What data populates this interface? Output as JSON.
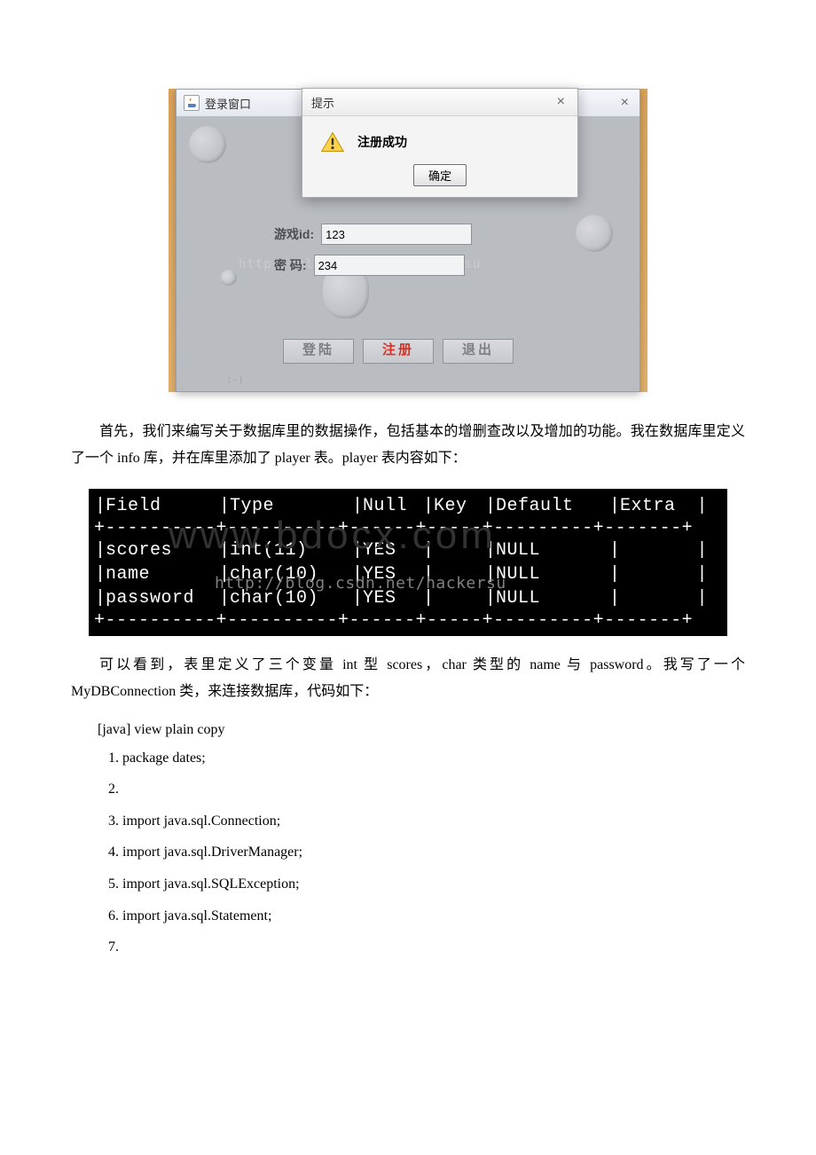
{
  "screenshot1": {
    "window_title": "登录窗口",
    "dialog": {
      "title": "提示",
      "message": "注册成功",
      "ok_label": "确定"
    },
    "form": {
      "id_label": "游戏id:",
      "id_value": "123",
      "pwd_label": "密  码:",
      "pwd_value": "234"
    },
    "buttons": {
      "login": "登陆",
      "register": "注册",
      "exit": "退出"
    },
    "watermark_url": "http://blog.csdn.net/hackersu"
  },
  "text": {
    "para1": "首先，我们来编写关于数据库里的数据操作，包括基本的增删查改以及增加的功能。我在数据库里定义了一个 info 库，并在库里添加了 player 表。player 表内容如下：",
    "para2": "可以看到，表里定义了三个变量 int 型 scores，char 类型的 name 与 password。我写了一个 MyDBConnection 类，来连接数据库，代码如下：",
    "code_label": "[java] view plain copy"
  },
  "describe": {
    "headers": [
      "Field",
      "Type",
      "Null",
      "Key",
      "Default",
      "Extra"
    ],
    "rows": [
      {
        "field": "scores",
        "type": "int(11)",
        "null": "YES",
        "key": "",
        "default": "NULL",
        "extra": ""
      },
      {
        "field": "name",
        "type": "char(10)",
        "null": "YES",
        "key": "",
        "default": "NULL",
        "extra": ""
      },
      {
        "field": "password",
        "type": "char(10)",
        "null": "YES",
        "key": "",
        "default": "NULL",
        "extra": ""
      }
    ],
    "watermark_big": "www.bdocx.com",
    "watermark_small": "http://blog.csdn.net/hackersu"
  },
  "code_lines": [
    "package dates;",
    "",
    "import java.sql.Connection;",
    "import java.sql.DriverManager;",
    "import java.sql.SQLException;",
    "import java.sql.Statement;",
    ""
  ]
}
